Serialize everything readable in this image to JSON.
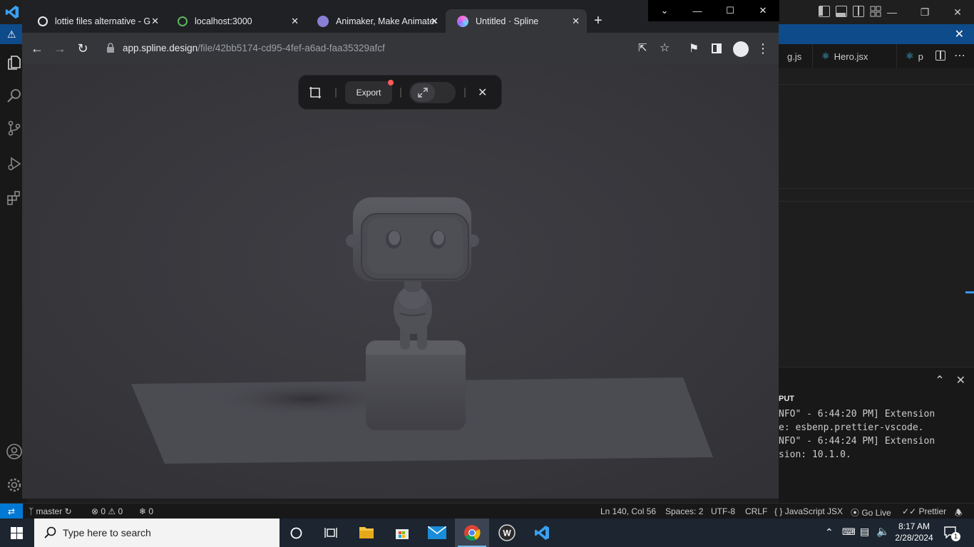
{
  "vscode": {
    "tabs": [
      {
        "label": "g.js"
      },
      {
        "label": "Hero.jsx"
      },
      {
        "label": "p"
      }
    ],
    "panel": {
      "header": "PUT",
      "output_lines": [
        "NFO\" - 6:44:20 PM] Extension",
        "e: esbenp.prettier-vscode.",
        "NFO\" - 6:44:24 PM] Extension",
        "sion: 10.1.0."
      ]
    },
    "statusbar": {
      "branch": "master",
      "errors": "0",
      "warnings": "0",
      "ports": "0",
      "position": "Ln 140, Col 56",
      "spaces": "Spaces: 2",
      "encoding": "UTF-8",
      "eol": "CRLF",
      "language": "JavaScript JSX",
      "golive": "Go Live",
      "prettier": "Prettier"
    }
  },
  "chrome": {
    "tabs": [
      {
        "title": "lottie files alternative - G",
        "favicon_color": "#e8eaed"
      },
      {
        "title": "localhost:3000",
        "favicon_color": "#5fb760"
      },
      {
        "title": "Animaker, Make Animated",
        "favicon_color": "#8a7fd6"
      },
      {
        "title": "Untitled · Spline",
        "favicon_color": "#c86cf2"
      }
    ],
    "url_host": "app.spline.design",
    "url_path": "/file/42bb5174-cd95-4fef-a6ad-faa35329afcf"
  },
  "spline": {
    "export_label": "Export"
  },
  "taskbar": {
    "search_placeholder": "Type here to search",
    "time": "8:17 AM",
    "date": "2/28/2024",
    "notification_count": "1"
  },
  "colors": {
    "taskbar_bg": "#1c2530",
    "vscode_blue": "#0078d4",
    "viewport_bg": "#3a3a3f"
  }
}
